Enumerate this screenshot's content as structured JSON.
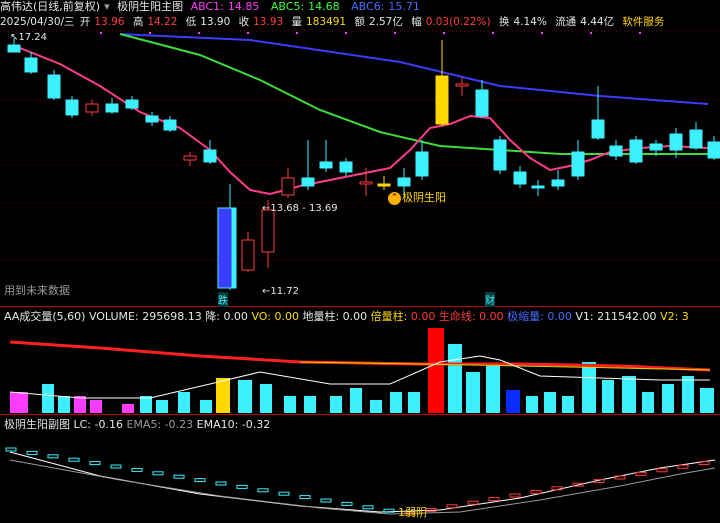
{
  "header": {
    "stock_name": "高伟达(日线,前复权)",
    "indicator_title": "极阴生阳主图",
    "abc1_label": "ABC1:",
    "abc1_value": "14.85",
    "abc5_label": "ABC5:",
    "abc5_value": "14.68",
    "abc6_label": "ABC6:",
    "abc6_value": "15.71"
  },
  "quote": {
    "date": "2025/04/30/三",
    "open_label": "开",
    "open": "13.96",
    "high_label": "高",
    "high": "14.22",
    "low_label": "低",
    "low": "13.90",
    "close_label": "收",
    "close": "13.93",
    "vol_label": "量",
    "vol": "183491",
    "amount_label": "额",
    "amount": "2.57亿",
    "change_label": "幅",
    "change": "0.03(0.22%)",
    "turnover_label": "换",
    "turnover": "4.14%",
    "float_label": "流通",
    "float": "4.44亿",
    "service": "软件服务"
  },
  "main": {
    "high_marker": "17.24",
    "mid_marker": "13.68 - 13.69",
    "low_marker": "11.72",
    "signal_label": "极阴生阳",
    "future_note": "用到未来数据",
    "tag_die": "跌",
    "tag_cai": "财"
  },
  "volume": {
    "title": "AA成交量(5,60)",
    "volume_label": "VOLUME:",
    "volume_value": "295698.13",
    "jiang_label": "降:",
    "jiang_value": "0.00",
    "vo_label": "VO:",
    "vo_value": "0.00",
    "diliang_label": "地量柱:",
    "diliang_value": "0.00",
    "beiliang_label": "倍量柱:",
    "beiliang_value": "0.00",
    "shengming_label": "生命线:",
    "shengming_value": "0.00",
    "jisuoliang_label": "极缩量:",
    "jisuoliang_value": "0.00",
    "v1_label": "V1:",
    "v1_value": "211542.00",
    "v2_label": "V2:",
    "v2_value": "3"
  },
  "sub": {
    "title": "极阴生阳副图",
    "lc_label": "LC:",
    "lc_value": "-0.16",
    "ema5_label": "EMA5:",
    "ema5_value": "-0.23",
    "ema10_label": "EMA10:",
    "ema10_value": "-0.32",
    "weak_label": "1弱阴"
  },
  "colors": {
    "up": "#ff3c3c",
    "down": "#3cf0ff",
    "ma_pink": "#ff3c8c",
    "ma_green": "#3cdc3c",
    "ma_blue": "#3c3cff",
    "signal": "#ffd800"
  }
}
